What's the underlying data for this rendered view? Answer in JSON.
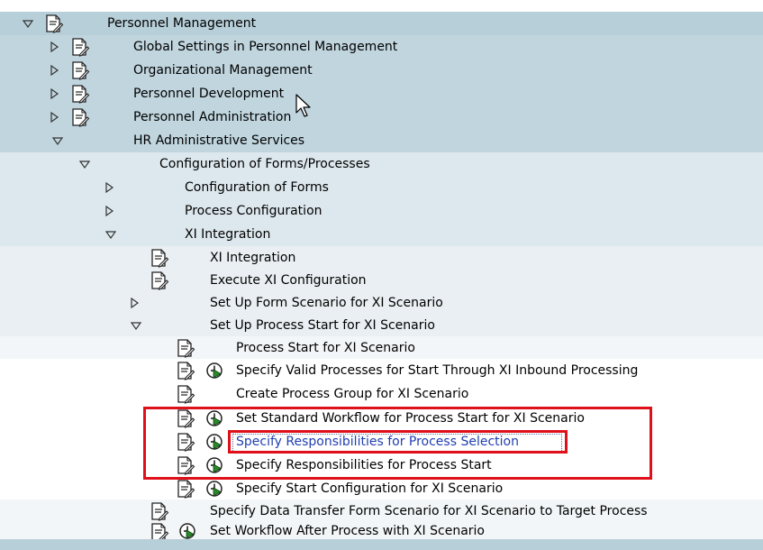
{
  "tree": {
    "rows": [
      {
        "label": "Personnel Management",
        "toggle": "expanded",
        "doc": true,
        "exec": false
      },
      {
        "label": "Global Settings in Personnel Management",
        "toggle": "collapsed",
        "doc": true,
        "exec": false
      },
      {
        "label": "Organizational Management",
        "toggle": "collapsed",
        "doc": true,
        "exec": false
      },
      {
        "label": "Personnel Development",
        "toggle": "collapsed",
        "doc": true,
        "exec": false
      },
      {
        "label": "Personnel Administration",
        "toggle": "collapsed",
        "doc": true,
        "exec": false
      },
      {
        "label": "HR Administrative Services",
        "toggle": "expanded",
        "doc": false,
        "exec": false
      },
      {
        "label": "Configuration of Forms/Processes",
        "toggle": "expanded",
        "doc": false,
        "exec": false
      },
      {
        "label": "Configuration of Forms",
        "toggle": "collapsed",
        "doc": false,
        "exec": false
      },
      {
        "label": "Process Configuration",
        "toggle": "collapsed",
        "doc": false,
        "exec": false
      },
      {
        "label": "XI Integration",
        "toggle": "expanded",
        "doc": false,
        "exec": false
      },
      {
        "label": "XI Integration",
        "toggle": "none",
        "doc": true,
        "exec": false
      },
      {
        "label": "Execute XI Configuration",
        "toggle": "none",
        "doc": true,
        "exec": false
      },
      {
        "label": "Set Up Form Scenario for XI Scenario",
        "toggle": "collapsed",
        "doc": false,
        "exec": false
      },
      {
        "label": "Set Up Process Start for XI Scenario",
        "toggle": "expanded",
        "doc": false,
        "exec": false
      },
      {
        "label": "Process Start for XI Scenario",
        "toggle": "none",
        "doc": true,
        "exec": false
      },
      {
        "label": "Specify Valid Processes for Start Through XI Inbound Processing",
        "toggle": "none",
        "doc": true,
        "exec": true
      },
      {
        "label": "Create Process Group for XI Scenario",
        "toggle": "none",
        "doc": true,
        "exec": false
      },
      {
        "label": "Set Standard Workflow for Process Start for XI Scenario",
        "toggle": "none",
        "doc": true,
        "exec": true
      },
      {
        "label": "Specify Responsibilities for Process Selection",
        "toggle": "none",
        "doc": true,
        "exec": true,
        "selected": true
      },
      {
        "label": "Specify Responsibilities for Process Start",
        "toggle": "none",
        "doc": true,
        "exec": true
      },
      {
        "label": "Specify Start Configuration for XI Scenario",
        "toggle": "none",
        "doc": true,
        "exec": true
      },
      {
        "label": "Specify Data Transfer Form Scenario for XI Scenario to Target Process",
        "toggle": "none",
        "doc": true,
        "exec": false
      },
      {
        "label": "Set Workflow After Process with XI Scenario",
        "toggle": "none",
        "doc": true,
        "exec": true
      }
    ]
  },
  "colors": {
    "highlight_box": "#e0101a",
    "selected_text": "#1f3fb0"
  },
  "icons": {
    "expanded": "triangle-down-icon",
    "collapsed": "triangle-right-icon",
    "doc": "documentation-icon",
    "exec": "execute-clock-icon",
    "cursor": "mouse-pointer-icon"
  }
}
